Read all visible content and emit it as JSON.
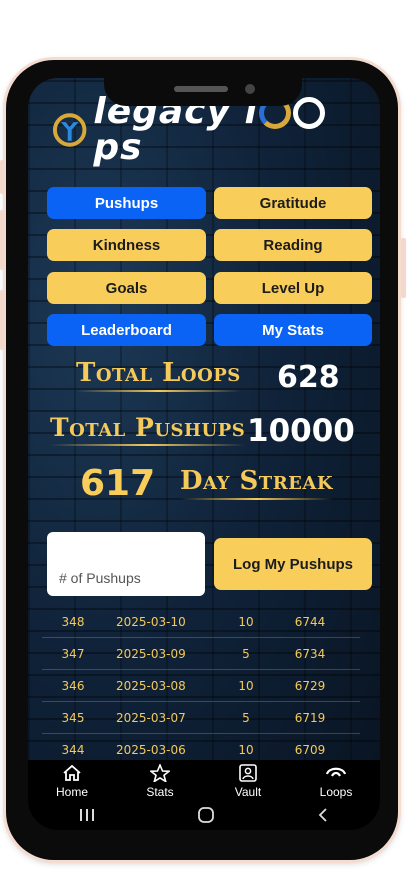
{
  "app": {
    "logo_text_prefix": "legacy l",
    "logo_text_suffix": "ps"
  },
  "buttons": {
    "pushups": "Pushups",
    "gratitude": "Gratitude",
    "kindness": "Kindness",
    "reading": "Reading",
    "goals": "Goals",
    "level_up": "Level Up",
    "leaderboard": "Leaderboard",
    "my_stats": "My Stats"
  },
  "stats": {
    "total_loops_label": "Total Loops",
    "total_loops_value": "628",
    "total_pushups_label": "Total Pushups",
    "total_pushups_value": "10000",
    "streak_value": "617",
    "streak_label": "Day Streak"
  },
  "log_form": {
    "input_placeholder": "# of Pushups",
    "submit_label": "Log My Pushups"
  },
  "log_rows": [
    {
      "id": "348",
      "date": "2025-03-10",
      "amount": "10",
      "total": "6744"
    },
    {
      "id": "347",
      "date": "2025-03-09",
      "amount": "5",
      "total": "6734"
    },
    {
      "id": "346",
      "date": "2025-03-08",
      "amount": "10",
      "total": "6729"
    },
    {
      "id": "345",
      "date": "2025-03-07",
      "amount": "5",
      "total": "6719"
    },
    {
      "id": "344",
      "date": "2025-03-06",
      "amount": "10",
      "total": "6709"
    }
  ],
  "nav": {
    "home": "Home",
    "stats": "Stats",
    "vault": "Vault",
    "loops": "Loops"
  },
  "icons": [
    "home-icon",
    "star-icon",
    "vault-icon",
    "loops-icon",
    "recents-icon",
    "home-circle-icon",
    "back-icon"
  ],
  "colors": {
    "blue": "#0b63f6",
    "gold": "#f9cd5a",
    "label_gold": "#f5c95a"
  }
}
